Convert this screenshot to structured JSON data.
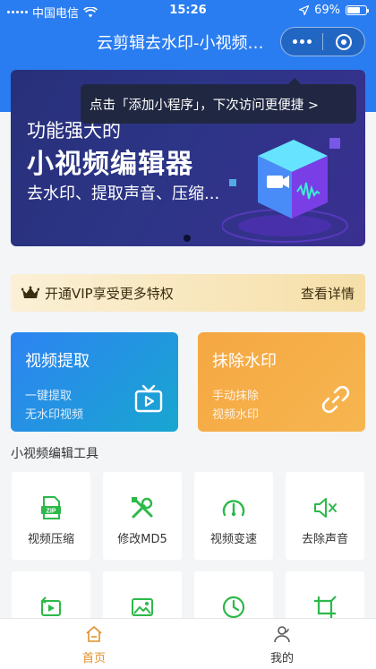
{
  "status_bar": {
    "carrier": "中国电信",
    "time": "15:26",
    "battery": "69%",
    "battery_level": 0.69
  },
  "nav": {
    "title": "云剪辑去水印-小视频…"
  },
  "banner": {
    "subtitle": "功能强大的",
    "title": "小视频编辑器",
    "description": "去水印、提取声音、压缩..."
  },
  "tooltip": {
    "text": "点击「添加小程序」，下次访问更便捷 >"
  },
  "vip": {
    "text": "开通VIP享受更多特权",
    "detail": "查看详情"
  },
  "cards": {
    "extract": {
      "title": "视频提取",
      "line1": "一键提取",
      "line2": "无水印视频"
    },
    "watermark": {
      "title": "抹除水印",
      "line1": "手动抹除",
      "line2": "视频水印"
    }
  },
  "tools_section": {
    "title": "小视频编辑工具",
    "items": [
      {
        "label": "视频压缩",
        "icon": "zip-icon"
      },
      {
        "label": "修改MD5",
        "icon": "tools-icon"
      },
      {
        "label": "视频变速",
        "icon": "speedometer-icon"
      },
      {
        "label": "去除声音",
        "icon": "mute-icon"
      },
      {
        "label": "",
        "icon": "video-rotate-icon"
      },
      {
        "label": "",
        "icon": "image-icon"
      },
      {
        "label": "",
        "icon": "clock-icon"
      },
      {
        "label": "",
        "icon": "crop-icon"
      }
    ]
  },
  "tabbar": {
    "home": "首页",
    "mine": "我的"
  },
  "colors": {
    "primary": "#2a7df0",
    "tool_green": "#2cb94a",
    "tab_active": "#e0902a",
    "card_blue": "#2e83f2",
    "card_orange": "#f5a742"
  }
}
